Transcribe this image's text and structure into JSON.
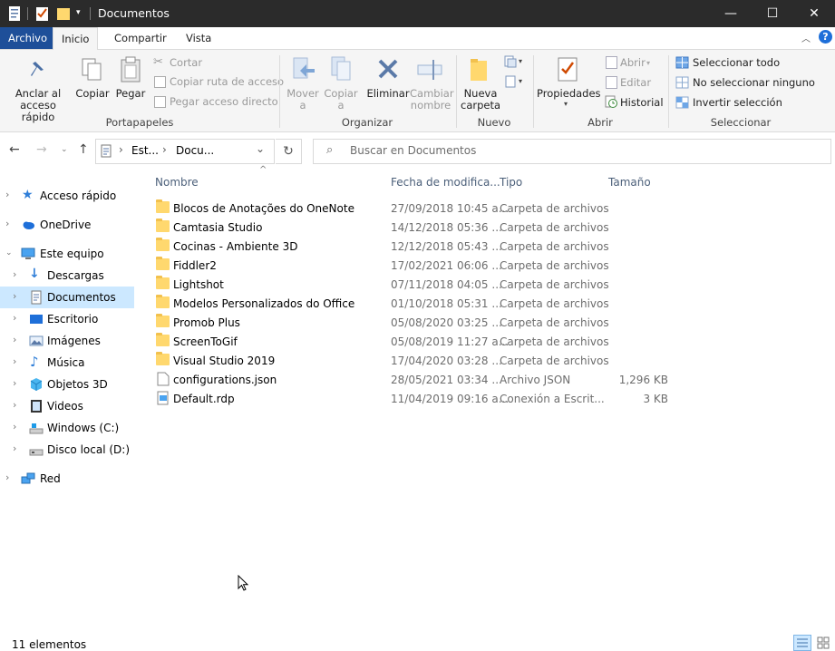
{
  "window": {
    "title": "Documentos",
    "minimize": "—",
    "maximize": "☐",
    "close": "✕"
  },
  "tabs": {
    "file": "Archivo",
    "home": "Inicio",
    "share": "Compartir",
    "view": "Vista"
  },
  "ribbon": {
    "clipboard": {
      "group_label": "Portapapeles",
      "pin": "Anclar al acceso rápido",
      "copy": "Copiar",
      "paste": "Pegar",
      "cut": "Cortar",
      "copy_path": "Copiar ruta de acceso",
      "paste_shortcut": "Pegar acceso directo"
    },
    "organize": {
      "group_label": "Organizar",
      "move_to": "Mover a",
      "copy_to": "Copiar a",
      "delete": "Eliminar",
      "rename": "Cambiar nombre"
    },
    "new": {
      "group_label": "Nuevo",
      "new_folder": "Nueva carpeta"
    },
    "open": {
      "group_label": "Abrir",
      "properties": "Propiedades",
      "open": "Abrir",
      "edit": "Editar",
      "history": "Historial"
    },
    "select": {
      "group_label": "Seleccionar",
      "select_all": "Seleccionar todo",
      "select_none": "No seleccionar ninguno",
      "invert": "Invertir selección"
    }
  },
  "address": {
    "crumbs": [
      "Est...",
      "Docu..."
    ],
    "search_placeholder": "Buscar en Documentos"
  },
  "nav": [
    {
      "label": "Acceso rápido",
      "icon": "star-icon"
    },
    {
      "label": "OneDrive",
      "icon": "cloud-icon"
    },
    {
      "label": "Este equipo",
      "icon": "computer-icon"
    },
    {
      "label": "Descargas",
      "icon": "download-icon"
    },
    {
      "label": "Documentos",
      "icon": "document-icon"
    },
    {
      "label": "Escritorio",
      "icon": "desktop-icon"
    },
    {
      "label": "Imágenes",
      "icon": "pictures-icon"
    },
    {
      "label": "Música",
      "icon": "music-icon"
    },
    {
      "label": "Objetos 3D",
      "icon": "cube-icon"
    },
    {
      "label": "Videos",
      "icon": "video-icon"
    },
    {
      "label": "Windows (C:)",
      "icon": "drive-icon"
    },
    {
      "label": "Disco local (D:)",
      "icon": "drive-icon"
    },
    {
      "label": "Red",
      "icon": "network-icon"
    }
  ],
  "columns": {
    "name": "Nombre",
    "date": "Fecha de modifica...",
    "type": "Tipo",
    "size": "Tamaño"
  },
  "files": [
    {
      "name": "Blocos de Anotações do OneNote",
      "date": "27/09/2018 10:45 a...",
      "type": "Carpeta de archivos",
      "size": "",
      "kind": "folder"
    },
    {
      "name": "Camtasia Studio",
      "date": "14/12/2018 05:36 ...",
      "type": "Carpeta de archivos",
      "size": "",
      "kind": "folder"
    },
    {
      "name": "Cocinas - Ambiente 3D",
      "date": "12/12/2018 05:43 ...",
      "type": "Carpeta de archivos",
      "size": "",
      "kind": "folder"
    },
    {
      "name": "Fiddler2",
      "date": "17/02/2021 06:06 ...",
      "type": "Carpeta de archivos",
      "size": "",
      "kind": "folder"
    },
    {
      "name": "Lightshot",
      "date": "07/11/2018 04:05 ...",
      "type": "Carpeta de archivos",
      "size": "",
      "kind": "folder"
    },
    {
      "name": "Modelos Personalizados do Office",
      "date": "01/10/2018 05:31 ...",
      "type": "Carpeta de archivos",
      "size": "",
      "kind": "folder"
    },
    {
      "name": "Promob Plus",
      "date": "05/08/2020 03:25 ...",
      "type": "Carpeta de archivos",
      "size": "",
      "kind": "folder"
    },
    {
      "name": "ScreenToGif",
      "date": "05/08/2019 11:27 a...",
      "type": "Carpeta de archivos",
      "size": "",
      "kind": "folder"
    },
    {
      "name": "Visual Studio 2019",
      "date": "17/04/2020 03:28 ...",
      "type": "Carpeta de archivos",
      "size": "",
      "kind": "folder"
    },
    {
      "name": "configurations.json",
      "date": "28/05/2021 03:34 ...",
      "type": "Archivo JSON",
      "size": "1,296 KB",
      "kind": "json"
    },
    {
      "name": "Default.rdp",
      "date": "11/04/2019 09:16 a...",
      "type": "Conexión a Escrit...",
      "size": "3 KB",
      "kind": "rdp"
    }
  ],
  "status": {
    "count": "11 elementos"
  },
  "colors": {
    "accent": "#1e4f99",
    "selected": "#cce8ff",
    "titlebar": "#2b2b2b",
    "folder": "#ffd86e"
  }
}
